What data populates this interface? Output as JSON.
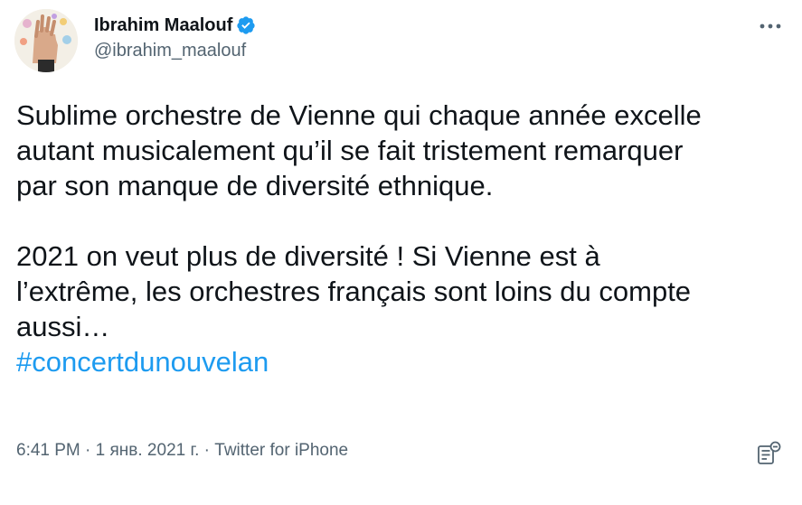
{
  "author": {
    "display_name": "Ibrahim Maalouf",
    "handle": "@ibrahim_maalouf",
    "verified": true,
    "avatar_icon": "avatar-hands-photo"
  },
  "tweet": {
    "lines": [
      "Sublime orchestre de Vienne qui chaque année excelle",
      "autant musicalement qu’il se fait tristement remarquer",
      "par son manque de diversité ethnique.",
      "",
      "2021 on veut plus de diversité ! Si Vienne est à",
      "l’extrême, les orchestres français sont loins du compte",
      "aussi…"
    ],
    "hashtag": "#concertdunouvelan"
  },
  "meta": {
    "time": "6:41 PM",
    "separator": " · ",
    "date": "1 янв. 2021 г.",
    "source": "Twitter for iPhone"
  },
  "icons": {
    "more": "more-dots-icon",
    "verified": "verified-badge-icon",
    "analytics": "analytics-icon"
  },
  "colors": {
    "text": "#0f1419",
    "secondary": "#536471",
    "link": "#1d9bf0",
    "verified": "#1d9bf0"
  }
}
